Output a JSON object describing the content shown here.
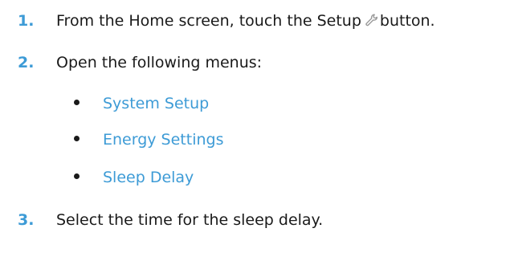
{
  "steps": [
    {
      "number": "1.",
      "text_before": "From the Home screen, touch the Setup",
      "text_after": "button.",
      "icon": "wrench-icon"
    },
    {
      "number": "2.",
      "text": "Open the following menus:"
    },
    {
      "number": "3.",
      "text": "Select the time for the sleep delay."
    }
  ],
  "menus": [
    {
      "label": "System Setup"
    },
    {
      "label": "Energy Settings"
    },
    {
      "label": "Sleep Delay"
    }
  ],
  "colors": {
    "accent": "#3d9bd6",
    "text": "#1a1a1a",
    "icon": "#9a9a9a"
  }
}
